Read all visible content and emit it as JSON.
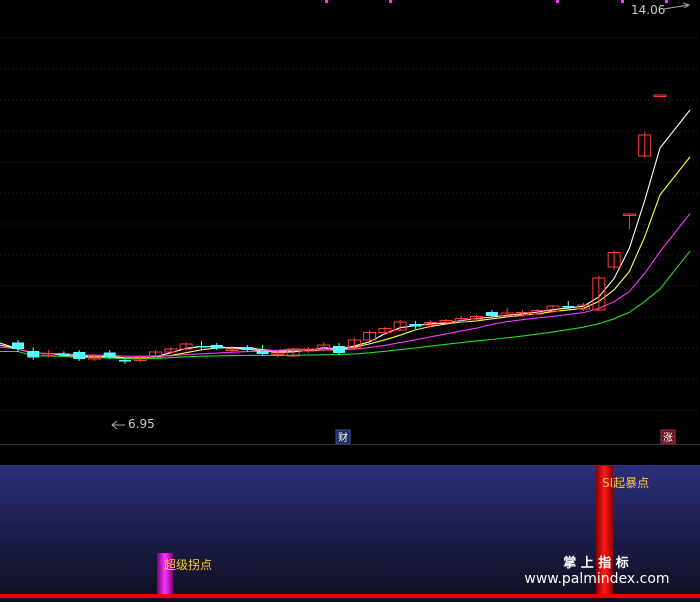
{
  "chart_data": [
    {
      "type": "candlestick",
      "price_max_label": "14.06",
      "price_min_label": "6.95",
      "ylim": [
        5.9,
        14.6
      ],
      "grid": "dotted",
      "candles": [
        {
          "o": 7.85,
          "c": 7.72,
          "h": 7.9,
          "l": 7.66,
          "up": false
        },
        {
          "o": 7.68,
          "c": 7.55,
          "h": 7.75,
          "l": 7.5,
          "up": false
        },
        {
          "o": 7.6,
          "c": 7.62,
          "h": 7.7,
          "l": 7.55,
          "up": true
        },
        {
          "o": 7.63,
          "c": 7.6,
          "h": 7.67,
          "l": 7.56,
          "up": false
        },
        {
          "o": 7.66,
          "c": 7.52,
          "h": 7.7,
          "l": 7.48,
          "up": false
        },
        {
          "o": 7.52,
          "c": 7.58,
          "h": 7.62,
          "l": 7.48,
          "up": true
        },
        {
          "o": 7.65,
          "c": 7.55,
          "h": 7.7,
          "l": 7.52,
          "up": false
        },
        {
          "o": 7.5,
          "c": 7.47,
          "h": 7.55,
          "l": 7.42,
          "up": false
        },
        {
          "o": 7.49,
          "c": 7.56,
          "h": 7.6,
          "l": 7.45,
          "up": true
        },
        {
          "o": 7.55,
          "c": 7.66,
          "h": 7.7,
          "l": 7.52,
          "up": true
        },
        {
          "o": 7.66,
          "c": 7.72,
          "h": 7.76,
          "l": 7.62,
          "up": true
        },
        {
          "o": 7.72,
          "c": 7.82,
          "h": 7.85,
          "l": 7.68,
          "up": true
        },
        {
          "o": 7.78,
          "c": 7.76,
          "h": 7.88,
          "l": 7.7,
          "up": false
        },
        {
          "o": 7.8,
          "c": 7.73,
          "h": 7.84,
          "l": 7.7,
          "up": false
        },
        {
          "o": 7.7,
          "c": 7.72,
          "h": 7.78,
          "l": 7.66,
          "up": true
        },
        {
          "o": 7.76,
          "c": 7.7,
          "h": 7.8,
          "l": 7.66,
          "up": false
        },
        {
          "o": 7.68,
          "c": 7.62,
          "h": 7.8,
          "l": 7.58,
          "up": false
        },
        {
          "o": 7.63,
          "c": 7.64,
          "h": 7.7,
          "l": 7.55,
          "up": true
        },
        {
          "o": 7.58,
          "c": 7.72,
          "h": 7.74,
          "l": 7.56,
          "up": true
        },
        {
          "o": 7.68,
          "c": 7.72,
          "h": 7.76,
          "l": 7.64,
          "up": true
        },
        {
          "o": 7.7,
          "c": 7.8,
          "h": 7.85,
          "l": 7.67,
          "up": true
        },
        {
          "o": 7.78,
          "c": 7.64,
          "h": 7.84,
          "l": 7.6,
          "up": false
        },
        {
          "o": 7.74,
          "c": 7.9,
          "h": 7.95,
          "l": 7.7,
          "up": true
        },
        {
          "o": 7.9,
          "c": 8.05,
          "h": 8.1,
          "l": 7.88,
          "up": true
        },
        {
          "o": 8.05,
          "c": 8.13,
          "h": 8.16,
          "l": 8.0,
          "up": true
        },
        {
          "o": 8.1,
          "c": 8.26,
          "h": 8.3,
          "l": 8.08,
          "up": true
        },
        {
          "o": 8.22,
          "c": 8.17,
          "h": 8.28,
          "l": 8.12,
          "up": false
        },
        {
          "o": 8.2,
          "c": 8.25,
          "h": 8.3,
          "l": 8.16,
          "up": true
        },
        {
          "o": 8.25,
          "c": 8.29,
          "h": 8.32,
          "l": 8.2,
          "up": true
        },
        {
          "o": 8.27,
          "c": 8.33,
          "h": 8.38,
          "l": 8.24,
          "up": true
        },
        {
          "o": 8.32,
          "c": 8.37,
          "h": 8.4,
          "l": 8.28,
          "up": true
        },
        {
          "o": 8.46,
          "c": 8.38,
          "h": 8.5,
          "l": 8.34,
          "up": false
        },
        {
          "o": 8.38,
          "c": 8.44,
          "h": 8.55,
          "l": 8.35,
          "up": true
        },
        {
          "o": 8.4,
          "c": 8.45,
          "h": 8.5,
          "l": 8.36,
          "up": true
        },
        {
          "o": 8.42,
          "c": 8.49,
          "h": 8.52,
          "l": 8.4,
          "up": true
        },
        {
          "o": 8.48,
          "c": 8.58,
          "h": 8.6,
          "l": 8.45,
          "up": true
        },
        {
          "o": 8.58,
          "c": 8.55,
          "h": 8.68,
          "l": 8.52,
          "up": false
        },
        {
          "o": 8.52,
          "c": 8.6,
          "h": 8.64,
          "l": 8.48,
          "up": true
        },
        {
          "o": 8.5,
          "c": 9.14,
          "h": 9.18,
          "l": 8.48,
          "up": true
        },
        {
          "o": 9.36,
          "c": 9.65,
          "h": 9.7,
          "l": 9.3,
          "up": true
        },
        {
          "o": 10.42,
          "c": 10.42,
          "h": 10.42,
          "l": 10.12,
          "up": true
        },
        {
          "o": 11.58,
          "c": 12.0,
          "h": 12.06,
          "l": 11.55,
          "up": true
        },
        {
          "o": 12.8,
          "c": 12.8,
          "h": 12.8,
          "l": 12.8,
          "up": true
        }
      ],
      "ma_colors": [
        "#ffffff",
        "#ffff44",
        "#ff33ff",
        "#22dd22"
      ]
    },
    {
      "type": "bar",
      "bars": [
        {
          "label": "超级拐点",
          "value": 0.32,
          "color": "#cc00cc"
        },
        {
          "label": "SI起暴点",
          "value": 1.0,
          "color": "#ee0000"
        }
      ]
    }
  ],
  "markers": {
    "cai": "财",
    "zhang": "涨"
  },
  "watermark": {
    "line1": "掌 上 指 标",
    "line2": "www.palmindex.com"
  },
  "colors": {
    "up": "#ff3b3b",
    "down": "#55ffff",
    "panel_top": "#2c2e7a",
    "panel_bottom": "#0e0e1e"
  }
}
